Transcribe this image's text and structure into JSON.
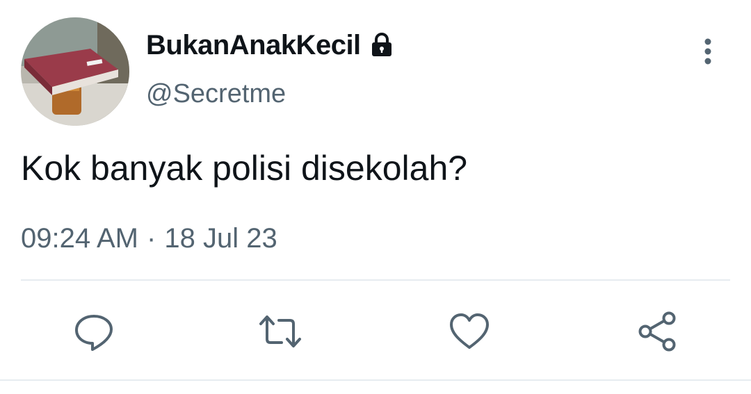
{
  "tweet": {
    "author": {
      "display_name": "BukanAnakKecil",
      "handle": "@Secretme",
      "protected_icon": "lock-icon"
    },
    "text": "Kok banyak polisi disekolah?",
    "time": "09:24 AM",
    "separator": "·",
    "date": "18 Jul 23"
  },
  "actions": {
    "icons": [
      "reply-icon",
      "retweet-icon",
      "like-icon",
      "share-icon"
    ]
  },
  "colors": {
    "text_primary": "#0f1419",
    "text_secondary": "#536471",
    "icon": "#536471",
    "divider": "#e6ecf0"
  }
}
